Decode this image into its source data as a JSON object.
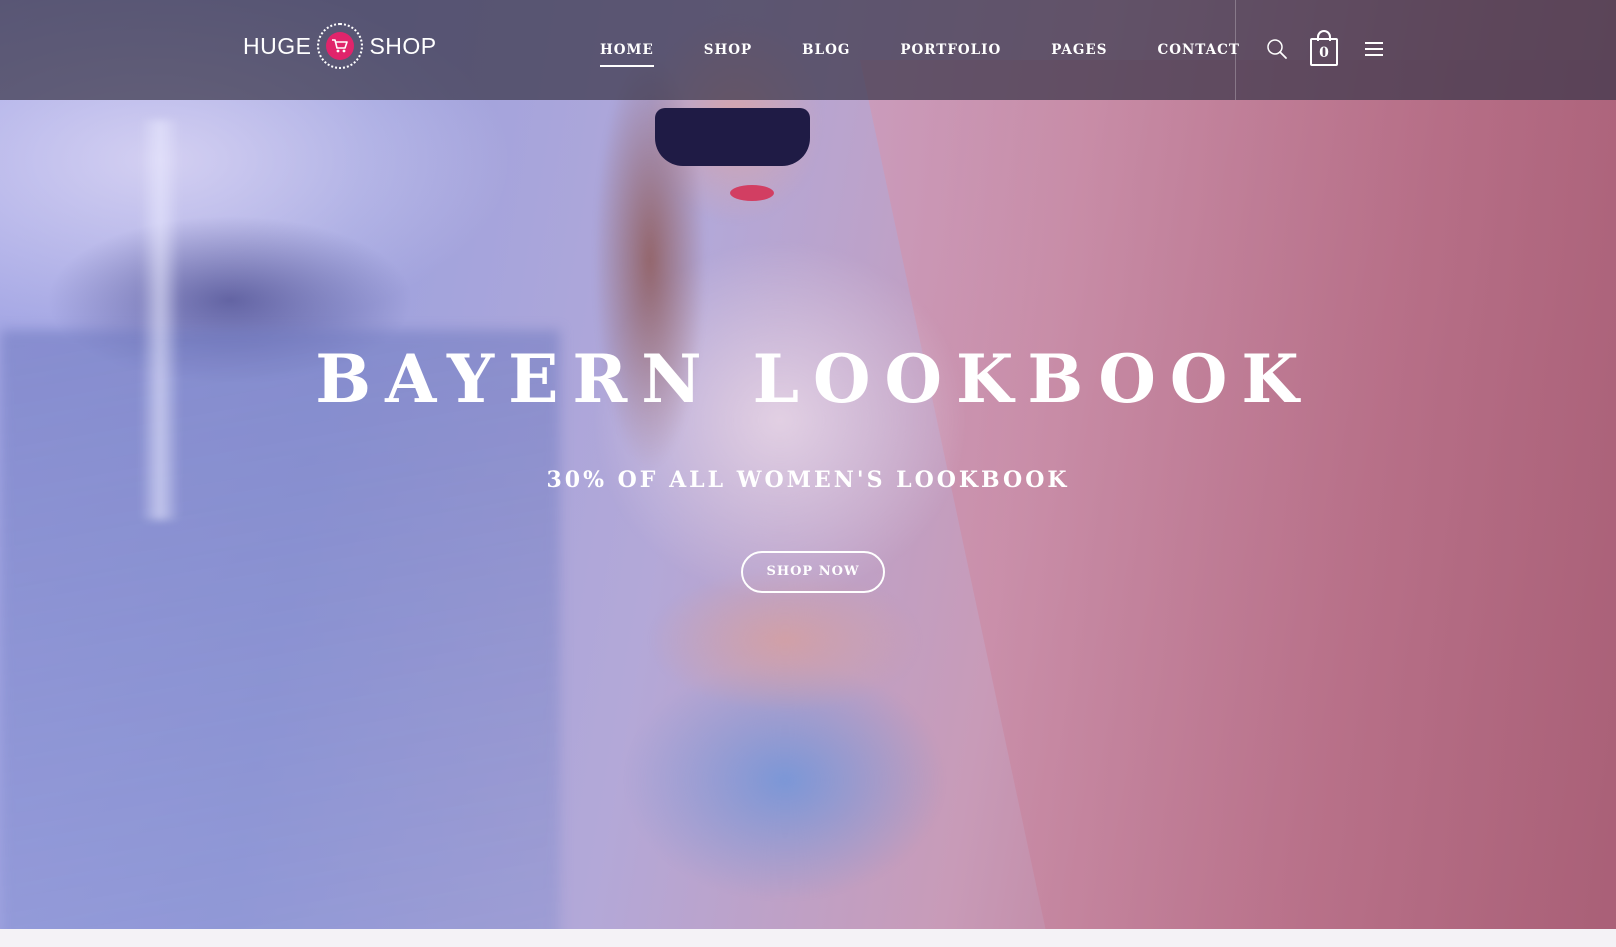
{
  "logo": {
    "left_text": "HUGE",
    "right_text": "SHOP",
    "badge_icon": "shopping-cart-icon",
    "badge_color": "#e0246b"
  },
  "nav": {
    "items": [
      {
        "label": "HOME",
        "active": true
      },
      {
        "label": "SHOP",
        "active": false
      },
      {
        "label": "BLOG",
        "active": false
      },
      {
        "label": "PORTFOLIO",
        "active": false
      },
      {
        "label": "PAGES",
        "active": false
      },
      {
        "label": "CONTACT",
        "active": false
      }
    ]
  },
  "header_actions": {
    "search_icon": "search-icon",
    "cart_icon": "shopping-bag-icon",
    "cart_count": "0",
    "menu_icon": "hamburger-menu-icon"
  },
  "hero": {
    "title": "BAYERN LOOKBOOK",
    "subtitle": "30% OF ALL WOMEN'S LOOKBOOK",
    "cta_label": "SHOP NOW",
    "overlay_color": "#7f7fcf"
  }
}
